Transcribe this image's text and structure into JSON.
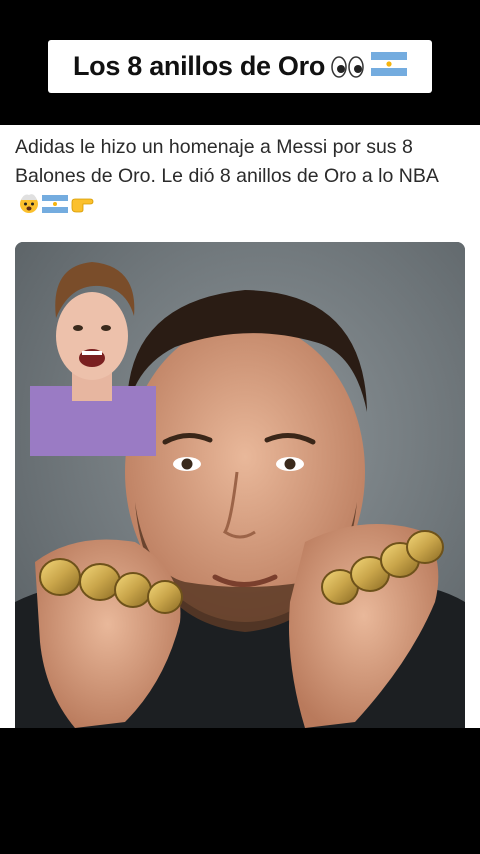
{
  "banner": {
    "title": "Los 8 anillos de Oro",
    "icons": [
      "eyes-icon",
      "argentina-flag-icon"
    ]
  },
  "post": {
    "text": "Adidas le hizo un homenaje a Messi por sus 8 Balones de Oro. Le dió 8 anillos de Oro a lo NBA",
    "emojis": [
      "exploding-head-icon",
      "argentina-flag-icon",
      "pointing-right-icon"
    ]
  },
  "colors": {
    "banner_bg": "#ffffff",
    "photo_bg": "#6d7478",
    "gold": "#c9a54a",
    "shirt": "#9a7bc4"
  }
}
